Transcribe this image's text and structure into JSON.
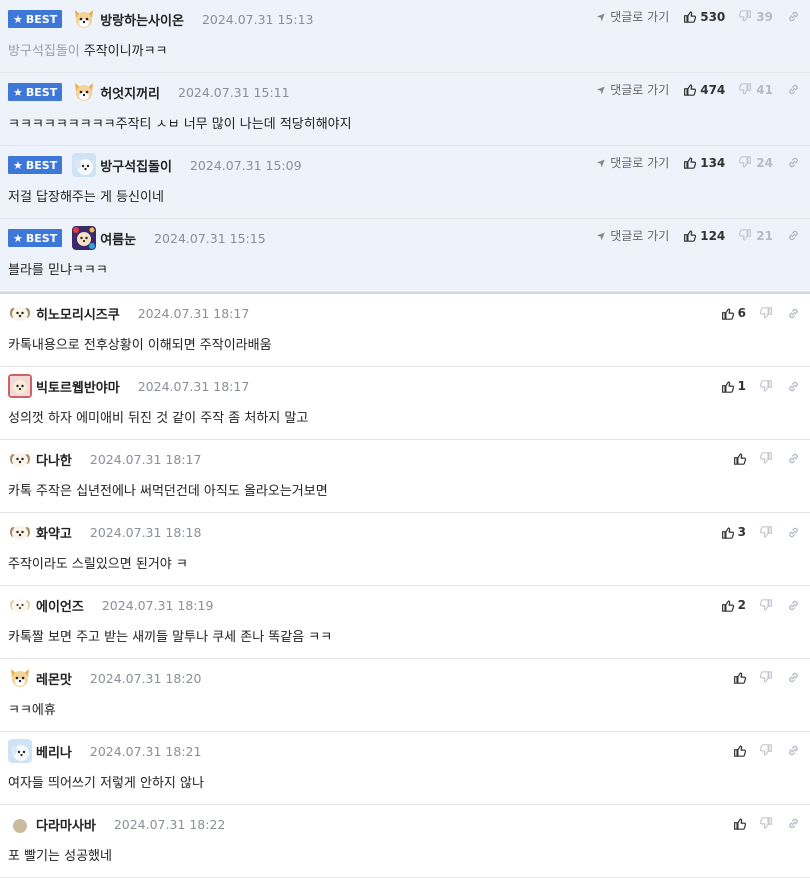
{
  "labels": {
    "best": "BEST",
    "goto": "댓글로 가기"
  },
  "colors": {
    "best_bg": "#eef2fb",
    "badge": "#3d78d8"
  },
  "best_comments": [
    {
      "nick": "방랑하는사이온",
      "date": "2024.07.31 15:13",
      "quote": "방구석집돌이",
      "text": "주작이니까ㅋㅋ",
      "likes": "530",
      "dislikes": "39",
      "avatar": "fox-icon"
    },
    {
      "nick": "허엇지꺼리",
      "date": "2024.07.31 15:11",
      "quote": "",
      "text": "ㅋㅋㅋㅋㅋㅋㅋㅋㅋ주작티 ㅅㅂ 너무 많이 나는데 적당히해야지",
      "likes": "474",
      "dislikes": "41",
      "avatar": "fox-icon"
    },
    {
      "nick": "방구석집돌이",
      "date": "2024.07.31 15:09",
      "quote": "",
      "text": "저걸 답장해주는 게 등신이네",
      "likes": "134",
      "dislikes": "24",
      "avatar": "puppy-blue-icon"
    },
    {
      "nick": "여름눈",
      "date": "2024.07.31 15:15",
      "quote": "",
      "text": "블라를 믿냐ㅋㅋㅋ",
      "likes": "124",
      "dislikes": "21",
      "avatar": "dog-colorful-icon"
    }
  ],
  "comments": [
    {
      "nick": "히노모리시즈쿠",
      "date": "2024.07.31 18:17",
      "text": "카톡내용으로 전후상황이 이해되면 주작이라배움",
      "likes": "6",
      "avatar": "puppy-icon"
    },
    {
      "nick": "빅토르웹반야마",
      "date": "2024.07.31 18:17",
      "text": "성의껏 하자 에미애비 뒤진 것 같이 주작 좀 처하지 말고",
      "likes": "1",
      "avatar": "dog-red-icon"
    },
    {
      "nick": "다나한",
      "date": "2024.07.31 18:17",
      "text": "카톡 주작은 십년전에나 써먹던건데 아직도 올라오는거보면",
      "likes": "",
      "avatar": "puppy-icon"
    },
    {
      "nick": "화약고",
      "date": "2024.07.31 18:18",
      "text": "주작이라도 스릴있으면 된거야 ㅋ",
      "likes": "3",
      "avatar": "puppy-icon"
    },
    {
      "nick": "에이언즈",
      "date": "2024.07.31 18:19",
      "text": "카톡짤 보면 주고 받는 새끼들 말투나 쿠세 존나 똑같음 ㅋㅋ",
      "likes": "2",
      "avatar": "puppy-light-icon"
    },
    {
      "nick": "레몬맛",
      "date": "2024.07.31 18:20",
      "text": "ㅋㅋ에휴",
      "likes": "",
      "avatar": "fox-icon"
    },
    {
      "nick": "베리나",
      "date": "2024.07.31 18:21",
      "text": "여자들 띄어쓰기 저렇게 안하지 않나",
      "likes": "",
      "avatar": "puppy-blue-icon"
    },
    {
      "nick": "다라마사바",
      "date": "2024.07.31 18:22",
      "text": "포 빨기는 성공했네",
      "likes": "",
      "avatar": "circle-avatar-icon"
    }
  ]
}
